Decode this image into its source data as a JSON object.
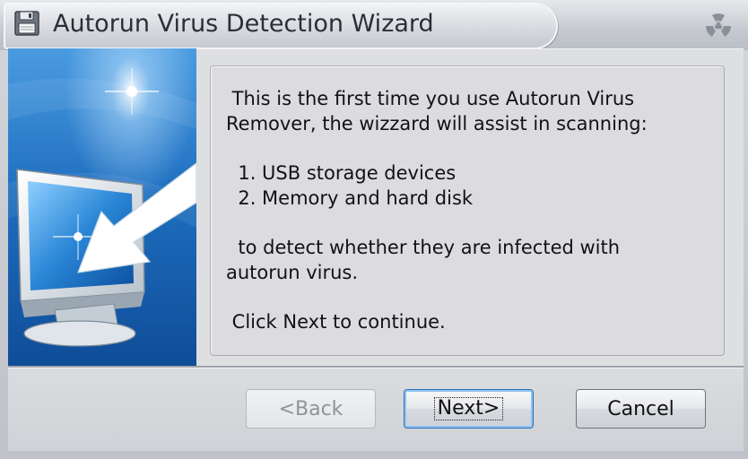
{
  "window": {
    "title": "Autorun Virus Detection Wizard",
    "app_icon": "floppy-disk-icon",
    "corner_icon": "radiation-icon"
  },
  "banner": {
    "icon": "monitor-with-arrow-illustration",
    "accent_color": "#2a86d6"
  },
  "info": {
    "intro_line1": " This is the first time you use Autorun Virus",
    "intro_line2": "Remover, the wizzard will assist in scanning:",
    "item1": "  1. USB storage devices",
    "item2": "  2. Memory and hard disk",
    "detect_line1": "  to detect whether they are infected with",
    "detect_line2": "autorun virus.",
    "continue_hint": " Click Next to continue."
  },
  "buttons": {
    "back_label": "<Back",
    "next_label": "Next>",
    "cancel_label": "Cancel"
  }
}
